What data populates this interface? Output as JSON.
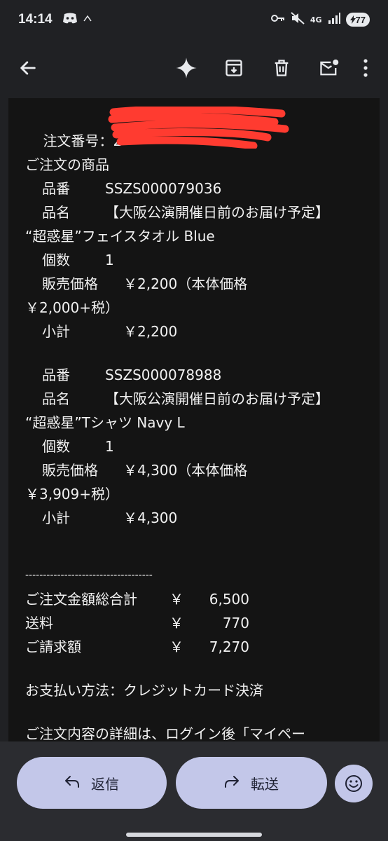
{
  "status_bar": {
    "time": "14:14",
    "network": "4G",
    "battery": "77"
  },
  "toolbar": {
    "icons": [
      "back-arrow-icon",
      "sparkle-icon",
      "archive-icon",
      "delete-icon",
      "mark-unread-icon",
      "more-vert-icon"
    ]
  },
  "email": {
    "order_number_label": "注文番号：",
    "order_number_redacted": "2",
    "items_heading": "ご注文の商品",
    "items": [
      {
        "sku_label": "品番",
        "sku": "SSZS000079036",
        "name_label": "品名",
        "name_line1": "【大阪公演開催日前のお届け予定】",
        "name_line2": "“超惑星”フェイスタオル Blue",
        "qty_label": "個数",
        "qty": "1",
        "price_label": "販売価格",
        "price": "￥2,200（本体価格",
        "price_line2": "￥2,000+税）",
        "subtotal_label": "小計",
        "subtotal": "￥2,200"
      },
      {
        "sku_label": "品番",
        "sku": "SSZS000078988",
        "name_label": "品名",
        "name_line1": "【大阪公演開催日前のお届け予定】",
        "name_line2": "“超惑星”Tシャツ Navy L",
        "qty_label": "個数",
        "qty": "1",
        "price_label": "販売価格",
        "price": "￥4,300（本体価格",
        "price_line2": "￥3,909+税）",
        "subtotal_label": "小計",
        "subtotal": "￥4,300"
      }
    ],
    "divider": "------------------------------------",
    "totals": [
      {
        "label": "ご注文金額総合計",
        "currency": "￥",
        "amount": "6,500"
      },
      {
        "label": "送料",
        "currency": "￥",
        "amount": "770"
      },
      {
        "label": "ご請求額",
        "currency": "￥",
        "amount": "7,270"
      }
    ],
    "payment": "お支払い方法：クレジットカード決済",
    "details_partial": "ご注文内容の詳細は、ログイン後「マイペー"
  },
  "actions": {
    "reply_label": "返信",
    "forward_label": "転送"
  },
  "colors": {
    "background": "#202124",
    "content_bg": "#141414",
    "pill": "#c3c7e9",
    "redaction": "#ff3b30"
  }
}
